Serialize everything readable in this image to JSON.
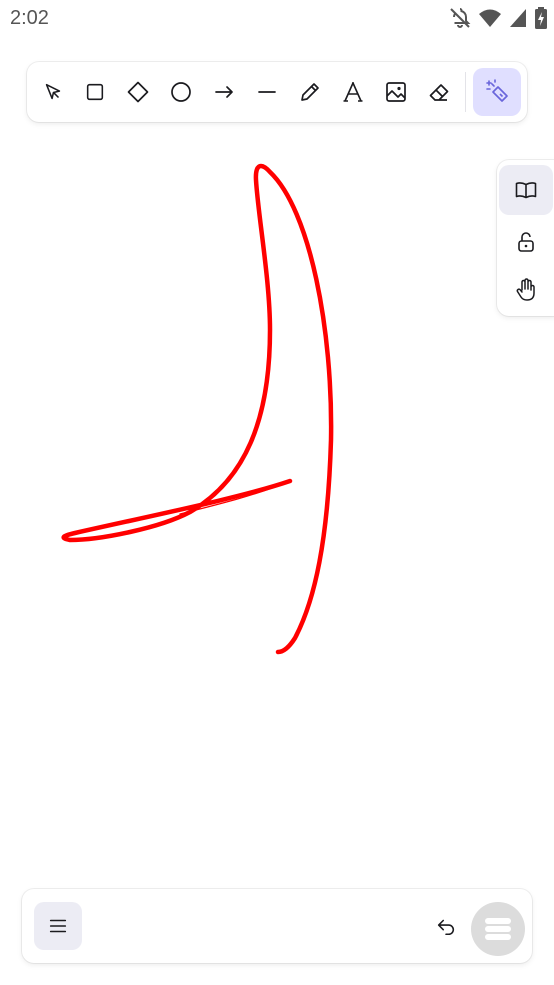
{
  "status_bar": {
    "time": "2:02",
    "icons": [
      "notifications-off-icon",
      "wifi-icon",
      "cell-signal-icon",
      "battery-charging-icon"
    ]
  },
  "toolbar": {
    "tools": [
      {
        "name": "selection",
        "icon": "pointer-icon"
      },
      {
        "name": "rectangle",
        "icon": "rectangle-icon"
      },
      {
        "name": "diamond",
        "icon": "diamond-icon"
      },
      {
        "name": "ellipse",
        "icon": "ellipse-icon"
      },
      {
        "name": "arrow",
        "icon": "arrow-right-icon"
      },
      {
        "name": "line",
        "icon": "line-icon"
      },
      {
        "name": "draw",
        "icon": "pencil-icon"
      },
      {
        "name": "text",
        "icon": "text-icon"
      },
      {
        "name": "image",
        "icon": "image-icon"
      },
      {
        "name": "eraser",
        "icon": "eraser-icon"
      },
      {
        "name": "laser",
        "icon": "laser-pointer-icon",
        "active": true
      }
    ],
    "active_color": "#e0dfff",
    "accent": "#6965db"
  },
  "side_panel": {
    "buttons": [
      {
        "name": "library",
        "icon": "book-open-icon",
        "active": true
      },
      {
        "name": "lock",
        "icon": "unlock-icon"
      },
      {
        "name": "hand",
        "icon": "hand-icon"
      }
    ]
  },
  "canvas": {
    "stroke_color": "#ff0000",
    "background": "#ffffff"
  },
  "bottom_bar": {
    "menu_icon": "hamburger-menu-icon",
    "undo_icon": "undo-icon",
    "fab_icon": "stack-menu-icon"
  }
}
